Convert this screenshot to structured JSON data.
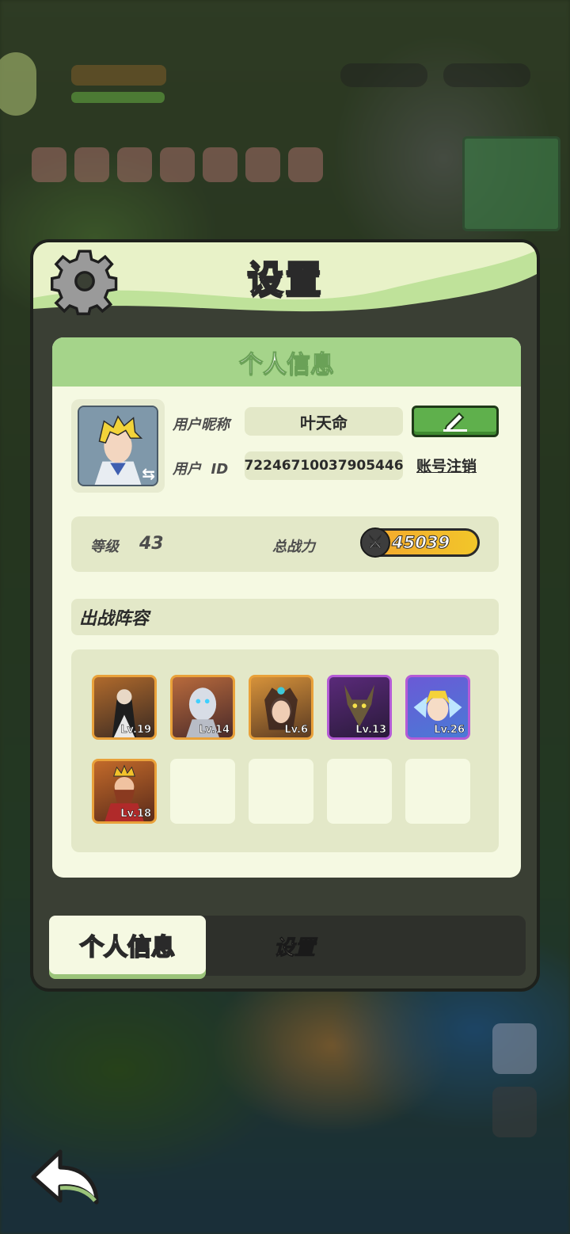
{
  "panel": {
    "title": "设置"
  },
  "profile": {
    "section_title": "个人信息",
    "nickname_label": "用户昵称",
    "nickname_value": "叶天命",
    "id_label": "用户  ID",
    "id_value": "72246710037905446",
    "cancel_account_label": "账号注销"
  },
  "stats": {
    "level_label": "等级",
    "level_value": "43",
    "power_label": "总战力",
    "power_value": "45039"
  },
  "lineup": {
    "title": "出战阵容",
    "heroes": [
      {
        "level": "Lv.19",
        "rarity": "orange"
      },
      {
        "level": "Lv.14",
        "rarity": "orange"
      },
      {
        "level": "Lv.6",
        "rarity": "orange"
      },
      {
        "level": "Lv.13",
        "rarity": "purple"
      },
      {
        "level": "Lv.26",
        "rarity": "purple"
      },
      {
        "level": "Lv.18",
        "rarity": "orange"
      }
    ],
    "empty_slots": 4
  },
  "tabs": {
    "active": "个人信息",
    "inactive": "设置"
  },
  "colors": {
    "header_green": "#bfe29a",
    "edit_button_green": "#5fb04c",
    "power_gold": "#f2c62a",
    "rarity_orange": "#e9a13a",
    "rarity_purple": "#b45bd6"
  }
}
